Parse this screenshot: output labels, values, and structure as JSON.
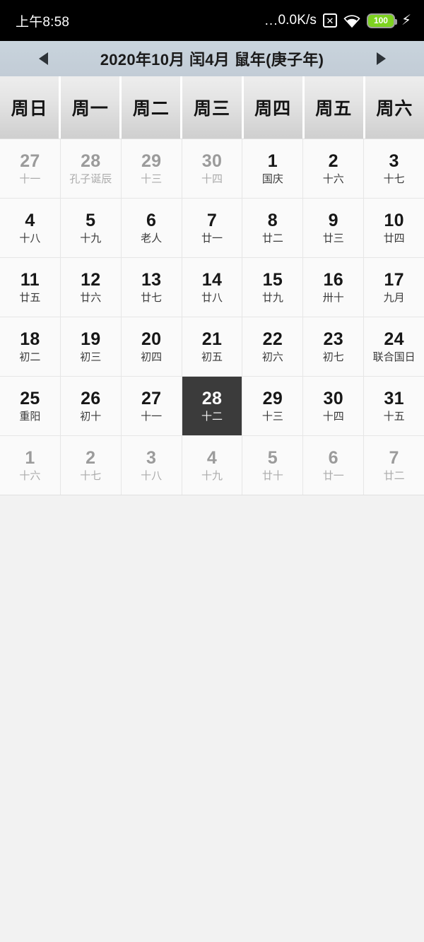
{
  "statusbar": {
    "time": "上午8:58",
    "network_speed": "0.0K/s",
    "speed_prefix": "...",
    "nosim_icon": "x-in-box-icon",
    "wifi_icon": "wifi-icon",
    "battery_level": "100",
    "charging_icon": "lightning-bolt-icon"
  },
  "titlebar": {
    "prev_label": "prev-month-arrow",
    "next_label": "next-month-arrow",
    "title": "2020年10月 闰4月 鼠年(庚子年)"
  },
  "weekdays": [
    "周日",
    "周一",
    "周二",
    "周三",
    "周四",
    "周五",
    "周六"
  ],
  "colors": {
    "titlebar_bg": "#c5d0da",
    "header_top": "#ededed",
    "header_bottom": "#cfcfcf",
    "cell_bg": "#fafafa",
    "selected_bg": "#3b3b3b",
    "selected_fg": "#ffffff",
    "other_month_fg": "#9b9b9b",
    "battery_green": "#7ed321"
  },
  "weeks": [
    [
      {
        "num": "27",
        "lunar": "十一",
        "other": true,
        "selected": false
      },
      {
        "num": "28",
        "lunar": "孔子诞辰",
        "other": true,
        "selected": false
      },
      {
        "num": "29",
        "lunar": "十三",
        "other": true,
        "selected": false
      },
      {
        "num": "30",
        "lunar": "十四",
        "other": true,
        "selected": false
      },
      {
        "num": "1",
        "lunar": "国庆",
        "other": false,
        "selected": false
      },
      {
        "num": "2",
        "lunar": "十六",
        "other": false,
        "selected": false
      },
      {
        "num": "3",
        "lunar": "十七",
        "other": false,
        "selected": false
      }
    ],
    [
      {
        "num": "4",
        "lunar": "十八",
        "other": false,
        "selected": false
      },
      {
        "num": "5",
        "lunar": "十九",
        "other": false,
        "selected": false
      },
      {
        "num": "6",
        "lunar": "老人",
        "other": false,
        "selected": false
      },
      {
        "num": "7",
        "lunar": "廿一",
        "other": false,
        "selected": false
      },
      {
        "num": "8",
        "lunar": "廿二",
        "other": false,
        "selected": false
      },
      {
        "num": "9",
        "lunar": "廿三",
        "other": false,
        "selected": false
      },
      {
        "num": "10",
        "lunar": "廿四",
        "other": false,
        "selected": false
      }
    ],
    [
      {
        "num": "11",
        "lunar": "廿五",
        "other": false,
        "selected": false
      },
      {
        "num": "12",
        "lunar": "廿六",
        "other": false,
        "selected": false
      },
      {
        "num": "13",
        "lunar": "廿七",
        "other": false,
        "selected": false
      },
      {
        "num": "14",
        "lunar": "廿八",
        "other": false,
        "selected": false
      },
      {
        "num": "15",
        "lunar": "廿九",
        "other": false,
        "selected": false
      },
      {
        "num": "16",
        "lunar": "卅十",
        "other": false,
        "selected": false
      },
      {
        "num": "17",
        "lunar": "九月",
        "other": false,
        "selected": false
      }
    ],
    [
      {
        "num": "18",
        "lunar": "初二",
        "other": false,
        "selected": false
      },
      {
        "num": "19",
        "lunar": "初三",
        "other": false,
        "selected": false
      },
      {
        "num": "20",
        "lunar": "初四",
        "other": false,
        "selected": false
      },
      {
        "num": "21",
        "lunar": "初五",
        "other": false,
        "selected": false
      },
      {
        "num": "22",
        "lunar": "初六",
        "other": false,
        "selected": false
      },
      {
        "num": "23",
        "lunar": "初七",
        "other": false,
        "selected": false
      },
      {
        "num": "24",
        "lunar": "联合国日",
        "other": false,
        "selected": false
      }
    ],
    [
      {
        "num": "25",
        "lunar": "重阳",
        "other": false,
        "selected": false
      },
      {
        "num": "26",
        "lunar": "初十",
        "other": false,
        "selected": false
      },
      {
        "num": "27",
        "lunar": "十一",
        "other": false,
        "selected": false
      },
      {
        "num": "28",
        "lunar": "十二",
        "other": false,
        "selected": true
      },
      {
        "num": "29",
        "lunar": "十三",
        "other": false,
        "selected": false
      },
      {
        "num": "30",
        "lunar": "十四",
        "other": false,
        "selected": false
      },
      {
        "num": "31",
        "lunar": "十五",
        "other": false,
        "selected": false
      }
    ],
    [
      {
        "num": "1",
        "lunar": "十六",
        "other": true,
        "selected": false
      },
      {
        "num": "2",
        "lunar": "十七",
        "other": true,
        "selected": false
      },
      {
        "num": "3",
        "lunar": "十八",
        "other": true,
        "selected": false
      },
      {
        "num": "4",
        "lunar": "十九",
        "other": true,
        "selected": false
      },
      {
        "num": "5",
        "lunar": "廿十",
        "other": true,
        "selected": false
      },
      {
        "num": "6",
        "lunar": "廿一",
        "other": true,
        "selected": false
      },
      {
        "num": "7",
        "lunar": "廿二",
        "other": true,
        "selected": false
      }
    ]
  ]
}
